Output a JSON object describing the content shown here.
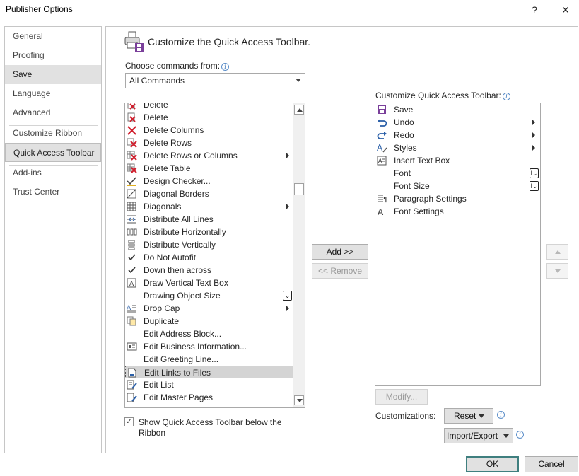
{
  "window": {
    "title": "Publisher Options",
    "help_label": "?",
    "close_label": "✕"
  },
  "nav": {
    "items": [
      {
        "label": "General"
      },
      {
        "label": "Proofing"
      },
      {
        "label": "Save"
      },
      {
        "label": "Language"
      },
      {
        "label": "Advanced"
      },
      {
        "label": "Customize Ribbon"
      },
      {
        "label": "Quick Access Toolbar",
        "selected": true
      },
      {
        "label": "Add-ins"
      },
      {
        "label": "Trust Center"
      }
    ]
  },
  "main": {
    "heading": "Customize the Quick Access Toolbar.",
    "choose_label": "Choose commands from:",
    "choose_value": "All Commands",
    "commands": [
      {
        "label": "Delete",
        "icon": "delete-red-x-icon"
      },
      {
        "label": "Delete",
        "icon": "delete-red-x-icon"
      },
      {
        "label": "Delete Columns",
        "icon": "delete-columns-icon"
      },
      {
        "label": "Delete Rows",
        "icon": "delete-rows-icon"
      },
      {
        "label": "Delete Rows or Columns",
        "icon": "delete-rows-columns-icon",
        "submenu": true
      },
      {
        "label": "Delete Table",
        "icon": "delete-table-icon"
      },
      {
        "label": "Design Checker...",
        "icon": "design-checker-icon"
      },
      {
        "label": "Diagonal Borders",
        "icon": "diagonal-borders-icon"
      },
      {
        "label": "Diagonals",
        "icon": "diagonals-grid-icon",
        "submenu": true
      },
      {
        "label": "Distribute All Lines",
        "icon": "distribute-all-lines-icon"
      },
      {
        "label": "Distribute Horizontally",
        "icon": "distribute-horizontally-icon"
      },
      {
        "label": "Distribute Vertically",
        "icon": "distribute-vertically-icon"
      },
      {
        "label": "Do Not Autofit",
        "icon": "checkmark-icon"
      },
      {
        "label": "Down then across",
        "icon": "checkmark-icon"
      },
      {
        "label": "Draw Vertical Text Box",
        "icon": "vertical-text-box-icon"
      },
      {
        "label": "Drawing Object Size",
        "icon": "",
        "control": "drawing-size-dropdown-icon"
      },
      {
        "label": "Drop Cap",
        "icon": "drop-cap-icon",
        "submenu": true
      },
      {
        "label": "Duplicate",
        "icon": "duplicate-icon"
      },
      {
        "label": "Edit Address Block...",
        "icon": ""
      },
      {
        "label": "Edit Business Information...",
        "icon": "business-info-icon"
      },
      {
        "label": "Edit Greeting Line...",
        "icon": ""
      },
      {
        "label": "Edit Links to Files",
        "icon": "edit-links-icon",
        "selected": true
      },
      {
        "label": "Edit List",
        "icon": "edit-list-icon"
      },
      {
        "label": "Edit Master Pages",
        "icon": "edit-master-pages-icon"
      },
      {
        "label": "Edit Objects",
        "icon": ""
      }
    ],
    "add_label": "Add >>",
    "remove_label": "<< Remove",
    "customize_label": "Customize Quick Access Toolbar:",
    "toolbar_items": [
      {
        "label": "Save",
        "icon": "save-disk-icon"
      },
      {
        "label": "Undo",
        "icon": "undo-arrow-icon",
        "split": true
      },
      {
        "label": "Redo",
        "icon": "redo-arrow-icon",
        "split": true
      },
      {
        "label": "Styles",
        "icon": "styles-icon",
        "submenu": true
      },
      {
        "label": "Insert Text Box",
        "icon": "text-box-icon"
      },
      {
        "label": "Font",
        "icon": "",
        "control": "font-combo-icon"
      },
      {
        "label": "Font Size",
        "icon": "",
        "control": "font-size-combo-icon"
      },
      {
        "label": "Paragraph Settings",
        "icon": "paragraph-settings-icon"
      },
      {
        "label": "Font Settings",
        "icon": "font-settings-icon"
      }
    ],
    "modify_label": "Modify...",
    "customizations_label": "Customizations:",
    "reset_label": "Reset",
    "import_export_label": "Import/Export",
    "show_below_label": "Show Quick Access Toolbar below the Ribbon",
    "show_below_checked": true
  },
  "footer": {
    "ok_label": "OK",
    "cancel_label": "Cancel"
  },
  "colors": {
    "accent_selected": "#e1e1e1",
    "delete_red": "#d0202e",
    "save_purple": "#7a3f9a",
    "undo_blue": "#2a5fa8",
    "default_button_border": "#3f7f7f"
  }
}
